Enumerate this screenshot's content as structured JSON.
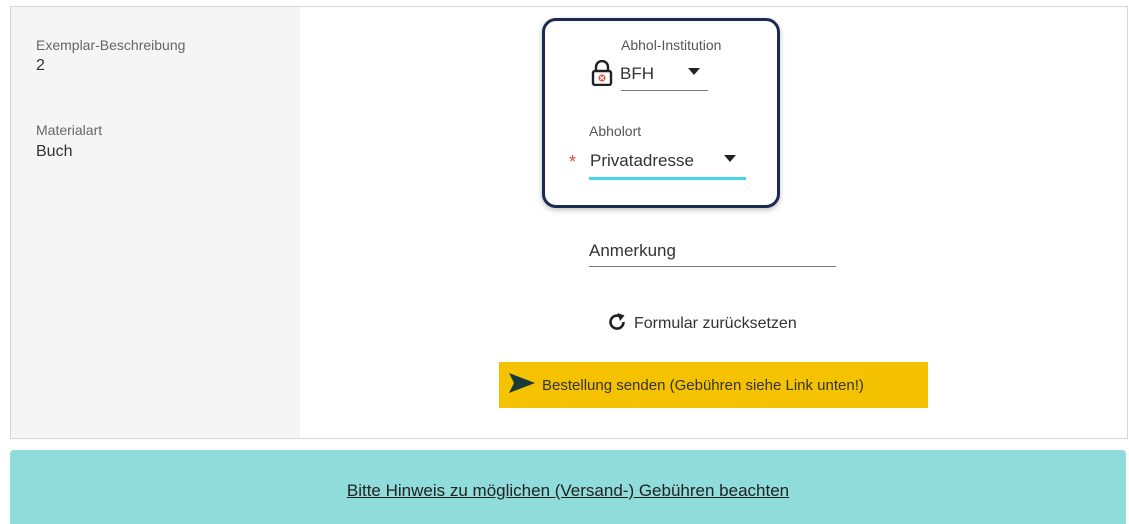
{
  "details": {
    "exemplar_label": "Exemplar-Beschreibung",
    "exemplar_value": "2",
    "material_label": "Materialart",
    "material_value": "Buch"
  },
  "form": {
    "institution": {
      "label": "Abhol-Institution",
      "value": "BFH"
    },
    "location": {
      "label": "Abholort",
      "value": "Privatadresse",
      "required_mark": "*"
    },
    "note": {
      "label": "Anmerkung"
    },
    "reset_label": "Formular zurücksetzen",
    "submit_label": "Bestellung senden (Gebühren siehe Link unten!)"
  },
  "banner": {
    "link_text": "Bitte Hinweis zu möglichen (Versand-) Gebühren beachten"
  },
  "colors": {
    "submit_bg": "#f5c200",
    "banner_bg": "#8fdcdb",
    "highlight_border": "#1b2a52",
    "active_underline": "#3fd8e8",
    "required": "#e04b3b"
  },
  "icons": [
    "lock-icon",
    "dropdown-caret-icon",
    "refresh-icon",
    "send-icon"
  ]
}
